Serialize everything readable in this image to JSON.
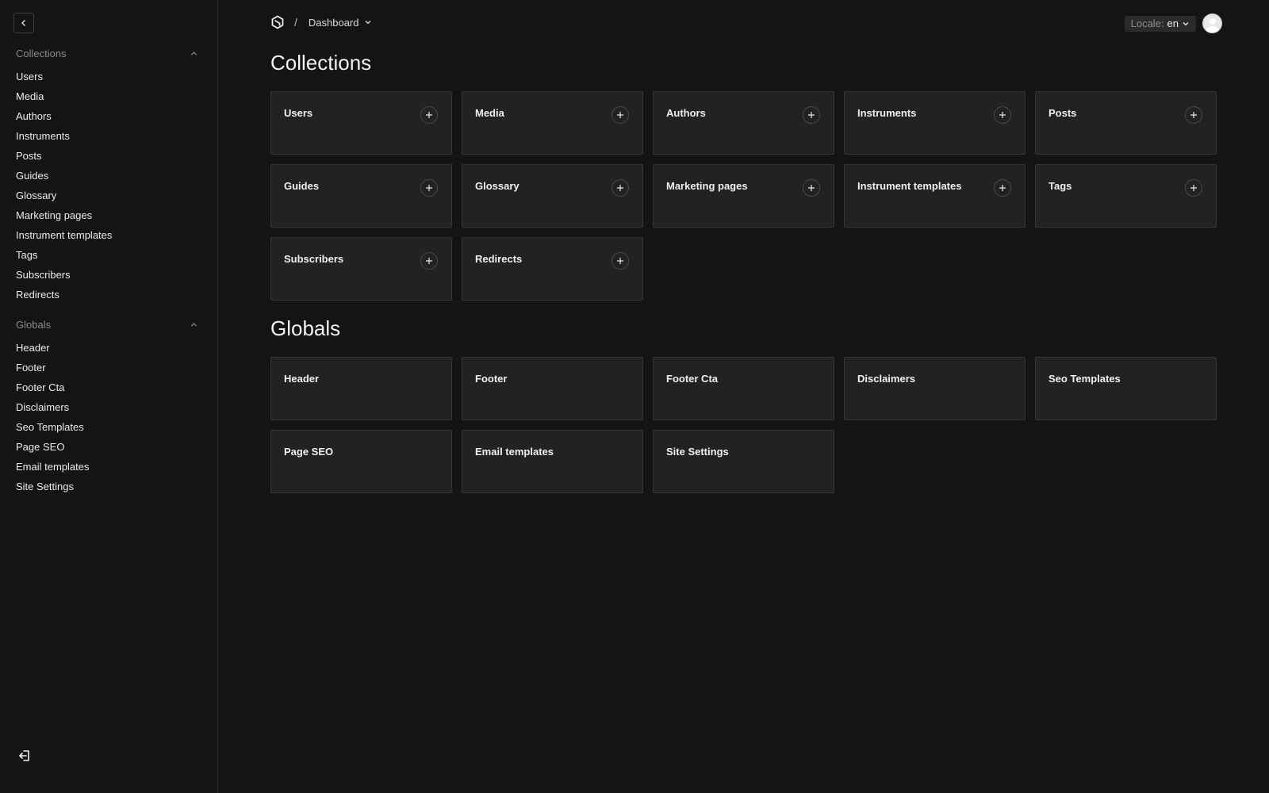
{
  "sidebar": {
    "collections_label": "Collections",
    "collections": [
      {
        "label": "Users"
      },
      {
        "label": "Media"
      },
      {
        "label": "Authors"
      },
      {
        "label": "Instruments"
      },
      {
        "label": "Posts"
      },
      {
        "label": "Guides"
      },
      {
        "label": "Glossary"
      },
      {
        "label": "Marketing pages"
      },
      {
        "label": "Instrument templates"
      },
      {
        "label": "Tags"
      },
      {
        "label": "Subscribers"
      },
      {
        "label": "Redirects"
      }
    ],
    "globals_label": "Globals",
    "globals": [
      {
        "label": "Header"
      },
      {
        "label": "Footer"
      },
      {
        "label": "Footer Cta"
      },
      {
        "label": "Disclaimers"
      },
      {
        "label": "Seo Templates"
      },
      {
        "label": "Page SEO"
      },
      {
        "label": "Email templates"
      },
      {
        "label": "Site Settings"
      }
    ]
  },
  "header": {
    "separator": "/",
    "breadcrumb": "Dashboard",
    "locale_label": "Locale:",
    "locale_value": "en"
  },
  "main": {
    "collections_title": "Collections",
    "collections": [
      {
        "label": "Users"
      },
      {
        "label": "Media"
      },
      {
        "label": "Authors"
      },
      {
        "label": "Instruments"
      },
      {
        "label": "Posts"
      },
      {
        "label": "Guides"
      },
      {
        "label": "Glossary"
      },
      {
        "label": "Marketing pages"
      },
      {
        "label": "Instrument templates"
      },
      {
        "label": "Tags"
      },
      {
        "label": "Subscribers"
      },
      {
        "label": "Redirects"
      }
    ],
    "globals_title": "Globals",
    "globals": [
      {
        "label": "Header"
      },
      {
        "label": "Footer"
      },
      {
        "label": "Footer Cta"
      },
      {
        "label": "Disclaimers"
      },
      {
        "label": "Seo Templates"
      },
      {
        "label": "Page SEO"
      },
      {
        "label": "Email templates"
      },
      {
        "label": "Site Settings"
      }
    ]
  },
  "icons": {
    "collapse": "chevron-left-icon",
    "group_toggle": "chevron-up-icon",
    "logout": "logout-icon",
    "logo": "payload-logo-icon",
    "dropdown": "chevron-down-icon",
    "add": "plus-icon",
    "avatar": "default-avatar-icon"
  },
  "colors": {
    "background": "#141414",
    "card": "#222222",
    "card_border": "#363636",
    "text": "#ebebeb",
    "muted": "#8a8a8a"
  }
}
